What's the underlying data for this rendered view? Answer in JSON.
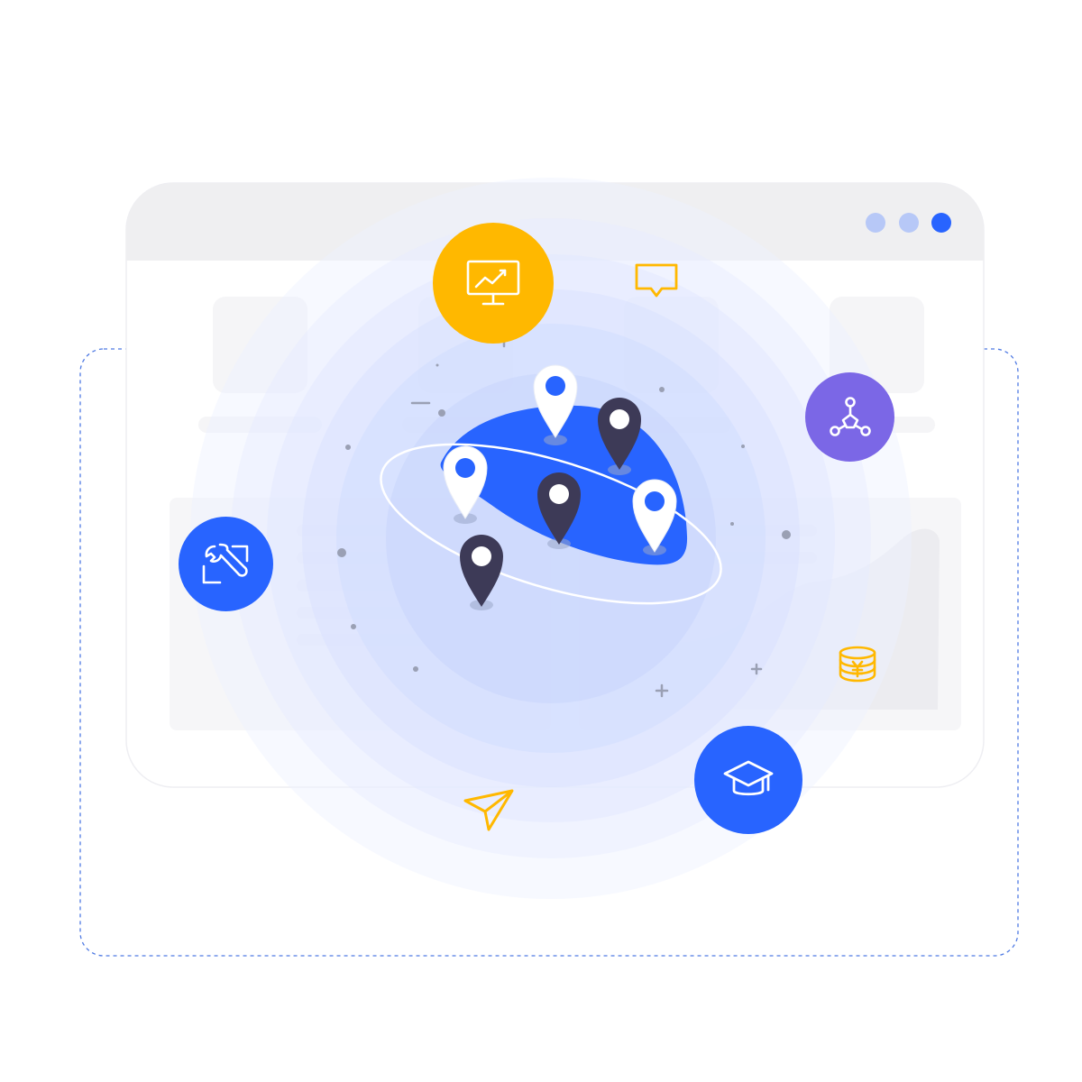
{
  "illustration": {
    "subject": "global-location-network",
    "colors": {
      "primary_blue": "#2864FF",
      "dark_pin": "#3D3A57",
      "amber": "#FFB800",
      "purple": "#7B67E6",
      "window_chrome": "#EFEFF1",
      "dashed_border": "#4F7AE3"
    },
    "window": {
      "controls": [
        {
          "name": "window-dot-1",
          "color": "#B7C8F7"
        },
        {
          "name": "window-dot-2",
          "color": "#B7C8F7"
        },
        {
          "name": "window-dot-3",
          "color": "#2864FF"
        }
      ]
    },
    "icons": [
      {
        "name": "monitor-chart-icon",
        "bg": "#FFB800"
      },
      {
        "name": "chat-bubble-icon",
        "bg": "none"
      },
      {
        "name": "network-nodes-icon",
        "bg": "#7B67E6"
      },
      {
        "name": "wrench-tools-icon",
        "bg": "#2864FF"
      },
      {
        "name": "coin-stack-icon",
        "bg": "none"
      },
      {
        "name": "graduation-cap-icon",
        "bg": "#2864FF"
      },
      {
        "name": "paper-plane-icon",
        "bg": "none"
      }
    ],
    "pins": [
      {
        "name": "map-pin-white-1",
        "style": "white"
      },
      {
        "name": "map-pin-dark-1",
        "style": "dark"
      },
      {
        "name": "map-pin-white-2",
        "style": "white"
      },
      {
        "name": "map-pin-dark-2",
        "style": "dark"
      },
      {
        "name": "map-pin-white-3",
        "style": "white"
      },
      {
        "name": "map-pin-dark-3",
        "style": "dark"
      }
    ]
  }
}
